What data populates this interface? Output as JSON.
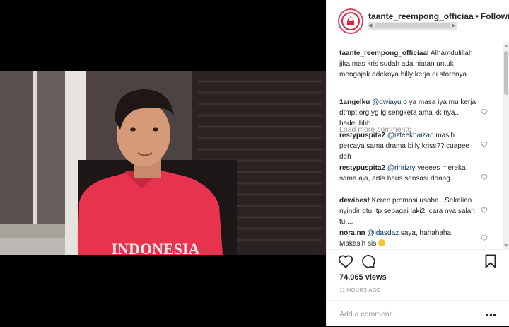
{
  "post": {
    "username": "taante_reempong_officiaa",
    "separator": "•",
    "follow_label": "Following"
  },
  "comments": [
    {
      "user": "taante_reempong_officiaal",
      "text": "Alhamdulillah jika mas kris sudah ada niatan untuk mengajak adeknya billy kerja di storenya"
    },
    {
      "user": "1angelku",
      "mention": "@dwiayu.o",
      "text": "ya masa iya mu kerja dtmpt org yg lg sengketa ama kk nya.. hadeuhhh.."
    },
    {
      "user": "restypuspita2",
      "mention": "@izteekhaizan",
      "text": "masih percaya sama drama billy kriss?? cuapee deh"
    },
    {
      "user": "restypuspita2",
      "mention": "@riririzty",
      "text": "yeeees mereka sama aja, artis haus sensasi doang"
    },
    {
      "user": "dewibest",
      "text": "Keren promosi usaha.. Sekalian nyindir gtu, tp sebagai laki2, cara nya salah tu...."
    },
    {
      "user": "nora.nn",
      "mention": "@idasdaz",
      "text": "saya, hahahaha. Makasih sis"
    }
  ],
  "load_more_label": "Load more comments",
  "views": "74,965 views",
  "timestamp": "11 HOURS AGO",
  "add_comment_placeholder": "Add a comment...",
  "more_options": "•••",
  "video": {
    "shirt_text": "INDONESIA"
  },
  "icons": [
    "heart-icon",
    "comment-icon",
    "bookmark-icon",
    "more-options-icon"
  ],
  "colors": {
    "link": "#003569",
    "muted": "#999999",
    "text": "#262626",
    "shirt": "#e8334f"
  }
}
